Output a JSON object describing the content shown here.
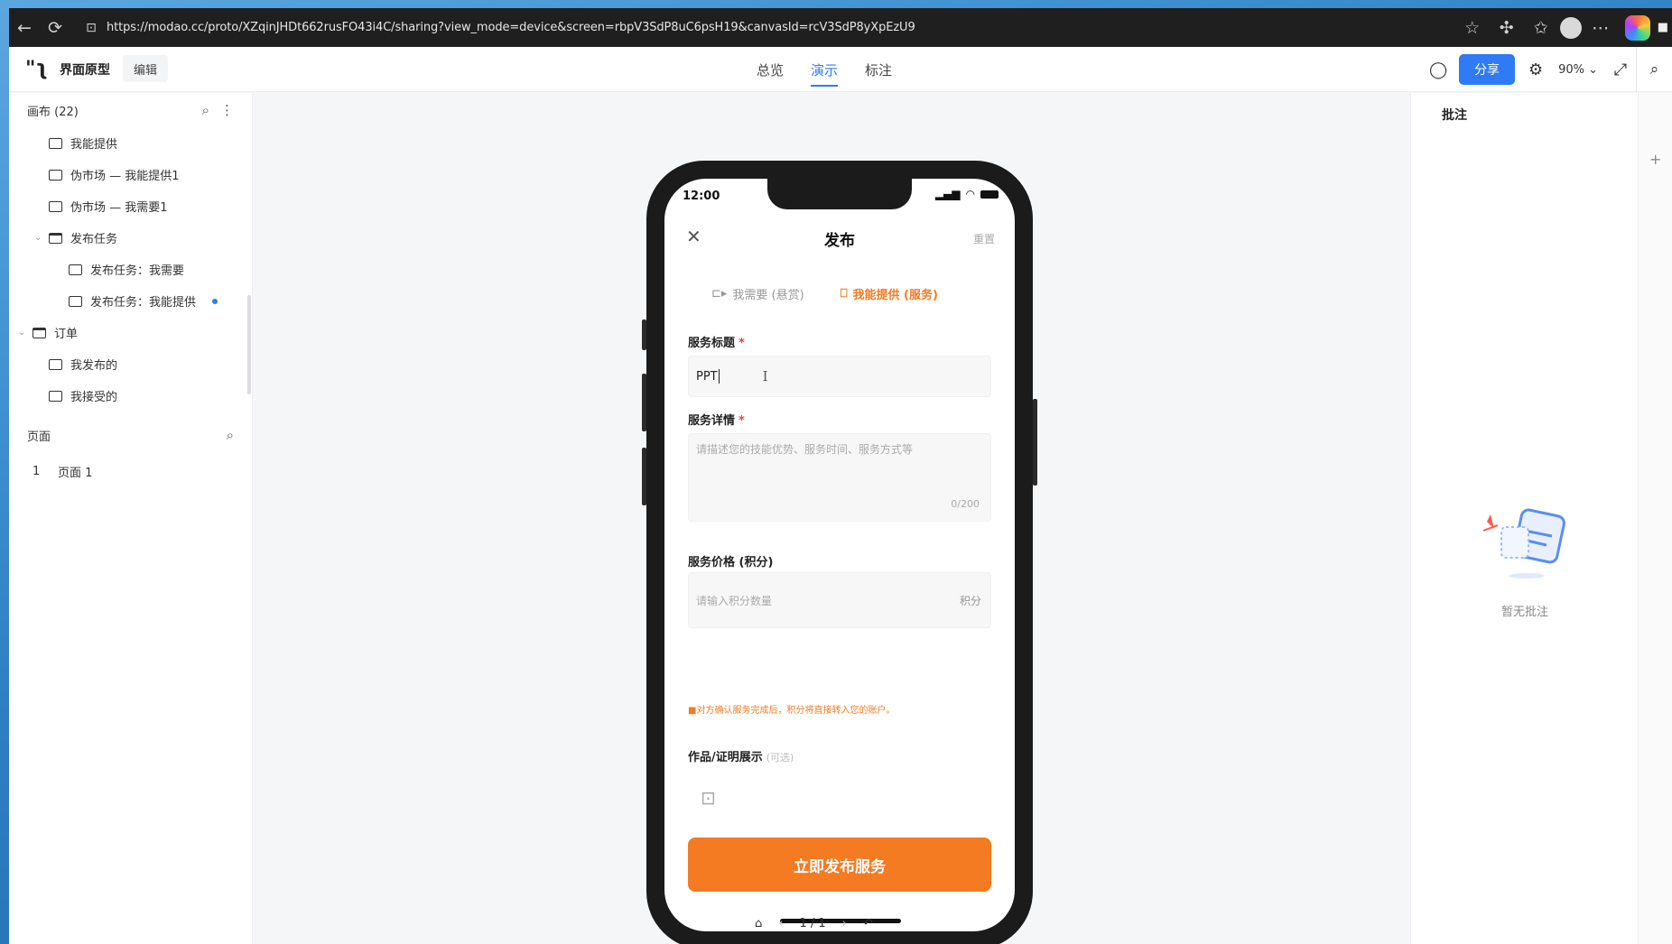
{
  "browser": {
    "url": "https://modao.cc/proto/XZqinJHDt662rusFO43i4C/sharing?view_mode=device&screen=rbpV3SdP8uC6psH19&canvasId=rcV3SdP8yXpEzU9"
  },
  "app": {
    "logo": "\"ʅ",
    "title": "界面原型",
    "edit_label": "编辑",
    "mode_tabs": [
      {
        "label": "总览"
      },
      {
        "label": "演示"
      },
      {
        "label": "标注"
      }
    ],
    "share_label": "分享",
    "zoom": "90%"
  },
  "left": {
    "canvas_header": "画布 (22)",
    "tree": [
      {
        "label": "我能提供"
      },
      {
        "label": "伪市场 — 我能提供1"
      },
      {
        "label": "伪市场 — 我需要1"
      },
      {
        "label": "发布任务"
      },
      {
        "label": "发布任务：我需要"
      },
      {
        "label": "发布任务：我能提供"
      },
      {
        "label": "订单"
      },
      {
        "label": "我发布的"
      },
      {
        "label": "我接受的"
      }
    ],
    "pages_header": "页面",
    "pages": [
      {
        "num": "1",
        "label": "页面 1"
      }
    ]
  },
  "right": {
    "title": "批注",
    "empty_text": "暂无批注"
  },
  "phone": {
    "time": "12:00",
    "nav_title": "发布",
    "nav_reset": "重置",
    "seg_need": "我需要 (悬赏)",
    "seg_offer": "我能提供 (服务)",
    "service_title_label": "服务标题",
    "service_title_value": "PPT",
    "service_detail_label": "服务详情",
    "service_detail_placeholder": "请描述您的技能优势、服务时间、服务方式等",
    "service_detail_counter": "0/200",
    "price_label": "服务价格 (积分)",
    "price_placeholder": "请输入积分数量",
    "price_unit": "积分",
    "price_hint": "■对方确认服务完成后，积分将直接转入您的账户。",
    "works_label": "作品/证明展示",
    "works_optional": "(可选)",
    "cta": "立即发布服务"
  },
  "pager": {
    "page": "1 / 1"
  }
}
